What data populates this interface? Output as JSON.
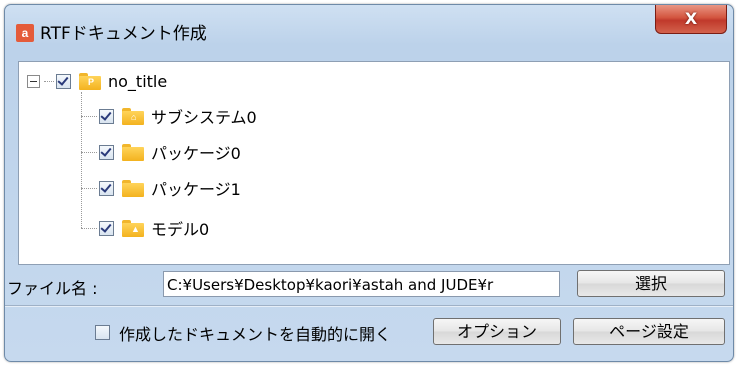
{
  "window": {
    "title": "RTFドキュメント作成",
    "close_label": "X",
    "app_icon_letter": "a"
  },
  "tree": {
    "root": {
      "label": "no_title",
      "icon": "project-folder-icon",
      "icon_mark": "P",
      "checked": true,
      "expanded": true
    },
    "children": [
      {
        "label": "サブシステム0",
        "icon": "subsystem-folder-icon",
        "icon_mark": "⌂",
        "checked": true
      },
      {
        "label": "パッケージ0",
        "icon": "package-folder-icon",
        "icon_mark": "",
        "checked": true
      },
      {
        "label": "パッケージ1",
        "icon": "package-folder-icon",
        "icon_mark": "",
        "checked": true
      },
      {
        "label": "モデル0",
        "icon": "model-folder-icon",
        "icon_mark": "▲",
        "checked": true
      }
    ]
  },
  "file": {
    "label": "ファイル名 :",
    "value": "C:¥Users¥Desktop¥kaori¥astah and JUDE¥r",
    "select_button": "選択"
  },
  "options": {
    "open_after_create_label": "作成したドキュメントを自動的に開く",
    "open_after_create_checked": false,
    "options_button": "オプション",
    "page_setup_button": "ページ設定"
  }
}
